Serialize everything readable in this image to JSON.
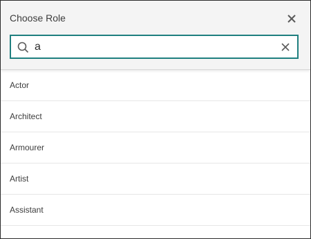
{
  "dialog": {
    "title": "Choose Role",
    "close_icon": "close-icon"
  },
  "search": {
    "value": "a",
    "placeholder": "",
    "search_icon": "search-icon",
    "clear_icon": "clear-icon",
    "accent_color": "#1f7f7f"
  },
  "roles": [
    {
      "label": "Actor"
    },
    {
      "label": "Architect"
    },
    {
      "label": "Armourer"
    },
    {
      "label": "Artist"
    },
    {
      "label": "Assistant"
    }
  ]
}
